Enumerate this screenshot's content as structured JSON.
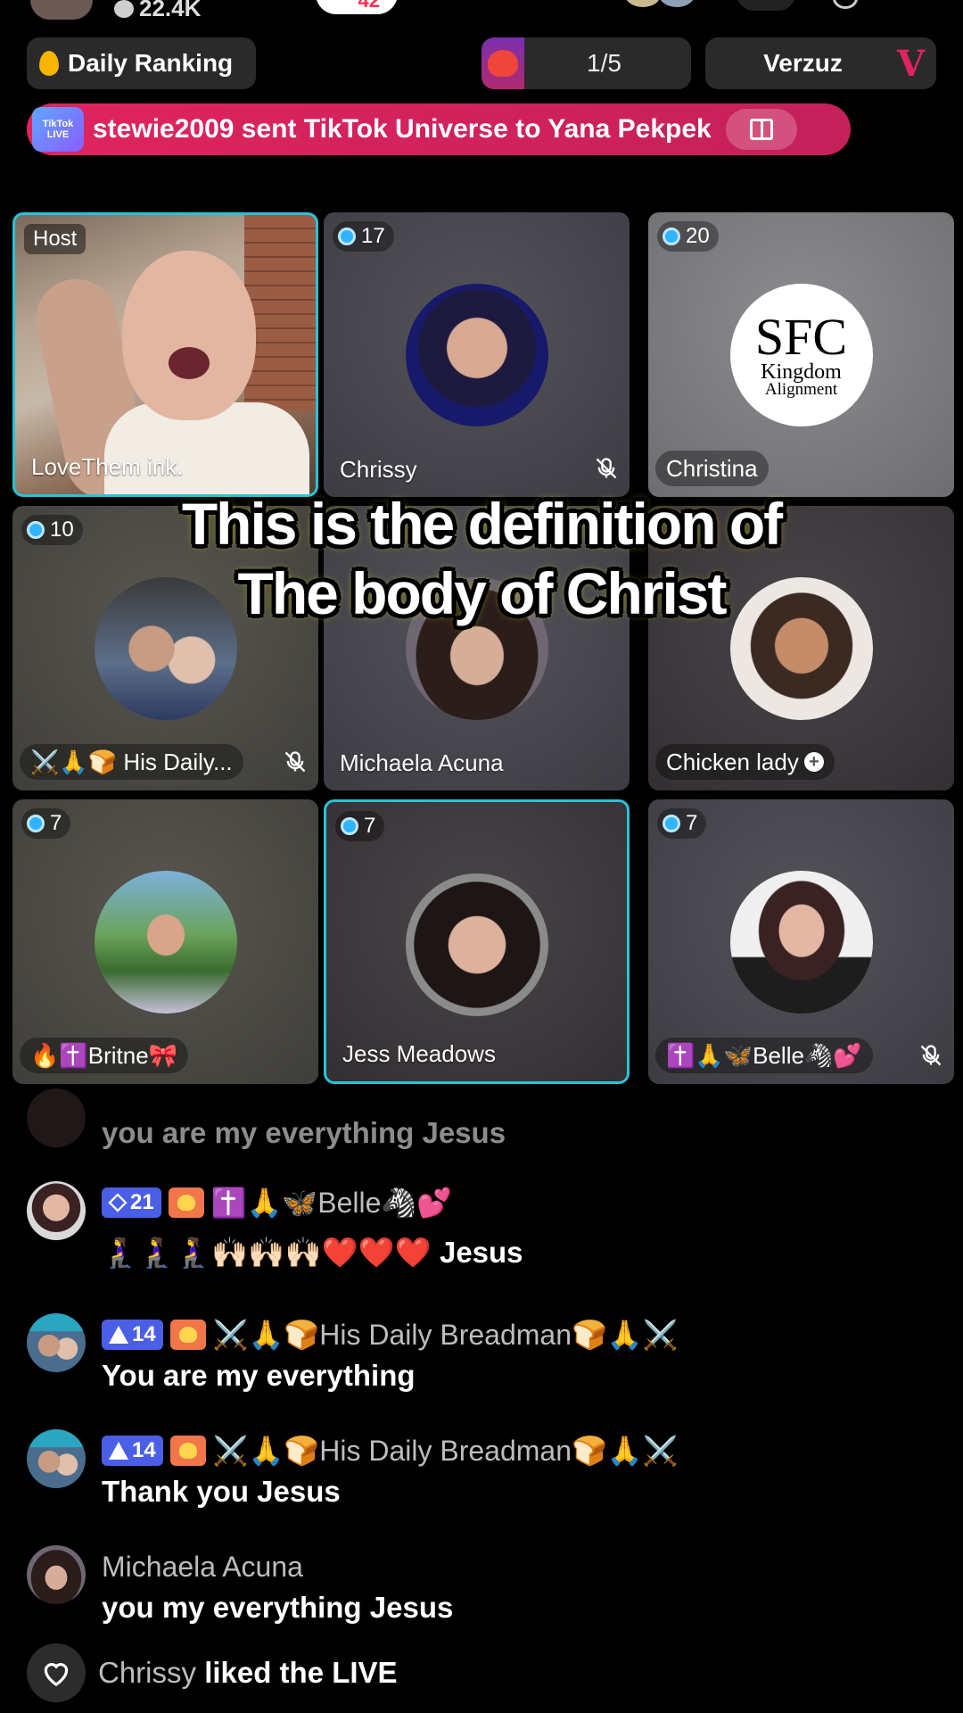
{
  "top": {
    "viewer_count": "22.4K",
    "pill_value": "42"
  },
  "ranking_bar": {
    "daily_ranking_label": "Daily Ranking",
    "battle_progress": "1/5",
    "verzuz_label": "Verzuz"
  },
  "gift_banner": {
    "logo_text": "TikTok LIVE",
    "text": "stewie2009 sent TikTok Universe to Yana Pekpek"
  },
  "grid": {
    "host": {
      "label": "Host",
      "name": "LoveThem ink."
    },
    "tiles": [
      {
        "score": "17",
        "name": "Chrissy",
        "muted": true
      },
      {
        "score": "20",
        "name": "Christina",
        "avatar_text": [
          "SFC",
          "Kingdom",
          "Alignment"
        ]
      },
      {
        "score": "10",
        "name": "⚔️🙏🍞 His Daily...",
        "muted": true
      },
      {
        "score": "",
        "name": "Michaela Acuna"
      },
      {
        "score": "",
        "name": "Chicken lady"
      },
      {
        "score": "7",
        "name": "🔥✝️Britne🎀"
      },
      {
        "score": "7",
        "name": "Jess Meadows"
      },
      {
        "score": "7",
        "name": "✝️🙏🦋Belle🦓💕",
        "muted": true
      }
    ]
  },
  "caption": {
    "line1": "This is the definition of",
    "line2": "The body of Christ"
  },
  "chat": [
    {
      "user": "",
      "message": "you are my everything Jesus"
    },
    {
      "level": "21",
      "user": "✝️🙏🦋Belle🦓💕",
      "message": "🧎‍♀️🧎‍♀️🧎‍♀️🙌🏻🙌🏻🙌🏻❤️❤️❤️ Jesus"
    },
    {
      "level": "14",
      "user": "⚔️🙏🍞His Daily Breadman🍞🙏⚔️",
      "message": "You are my everything"
    },
    {
      "level": "14",
      "user": "⚔️🙏🍞His Daily Breadman🍞🙏⚔️",
      "message": "Thank you Jesus"
    },
    {
      "user": "Michaela Acuna",
      "message": "you my everything Jesus"
    }
  ],
  "liked": {
    "user": "Chrissy",
    "text": "liked the LIVE"
  },
  "colors": {
    "accent_cyan": "#29c3d6",
    "brand_pink": "#e0245e",
    "level_badge": "#4b5fe6"
  },
  "icons": [
    "fire-icon",
    "heart-icon",
    "gift-icon",
    "mute-mic-icon",
    "plus-icon",
    "diamond-level-icon",
    "triangle-level-icon",
    "fan-heart-icon"
  ]
}
